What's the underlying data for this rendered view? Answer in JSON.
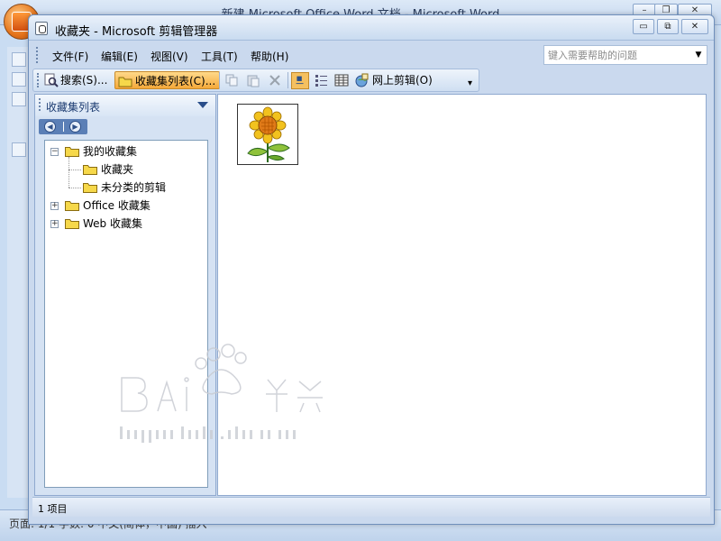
{
  "word": {
    "title": "新建 Microsoft Office Word 文档 - Microsoft Word",
    "status_text": "页面: 1/1    字数: 0    中文(简体，中国)    插入"
  },
  "clip": {
    "title": "收藏夹 - Microsoft 剪辑管理器",
    "minimize": "▭",
    "restore": "⧉",
    "close": "✕"
  },
  "menu": {
    "items": [
      {
        "label": "文件(F)"
      },
      {
        "label": "编辑(E)"
      },
      {
        "label": "视图(V)"
      },
      {
        "label": "工具(T)"
      },
      {
        "label": "帮助(H)"
      }
    ],
    "help_placeholder": "键入需要帮助的问题",
    "help_arrow": "▼"
  },
  "toolbar": {
    "search_label": "搜索(S)...",
    "collection_list_label": "收藏集列表(C)...",
    "online_clips_label": "网上剪辑(O)",
    "overflow": "▾"
  },
  "pane": {
    "title": "收藏集列表",
    "back": "◀",
    "forward": "▶"
  },
  "tree": {
    "my_collections": "我的收藏集",
    "favorites": "收藏夹",
    "unclassified": "未分类的剪辑",
    "office_collections": "Office 收藏集",
    "web_collections": "Web 收藏集",
    "expanded_sign": "−",
    "collapsed_sign": "+"
  },
  "status": {
    "text": "1 项目"
  },
  "colors": {
    "accent": "#f5a93a",
    "window_bg": "#cad9ee",
    "folder": "#f6d84a"
  }
}
